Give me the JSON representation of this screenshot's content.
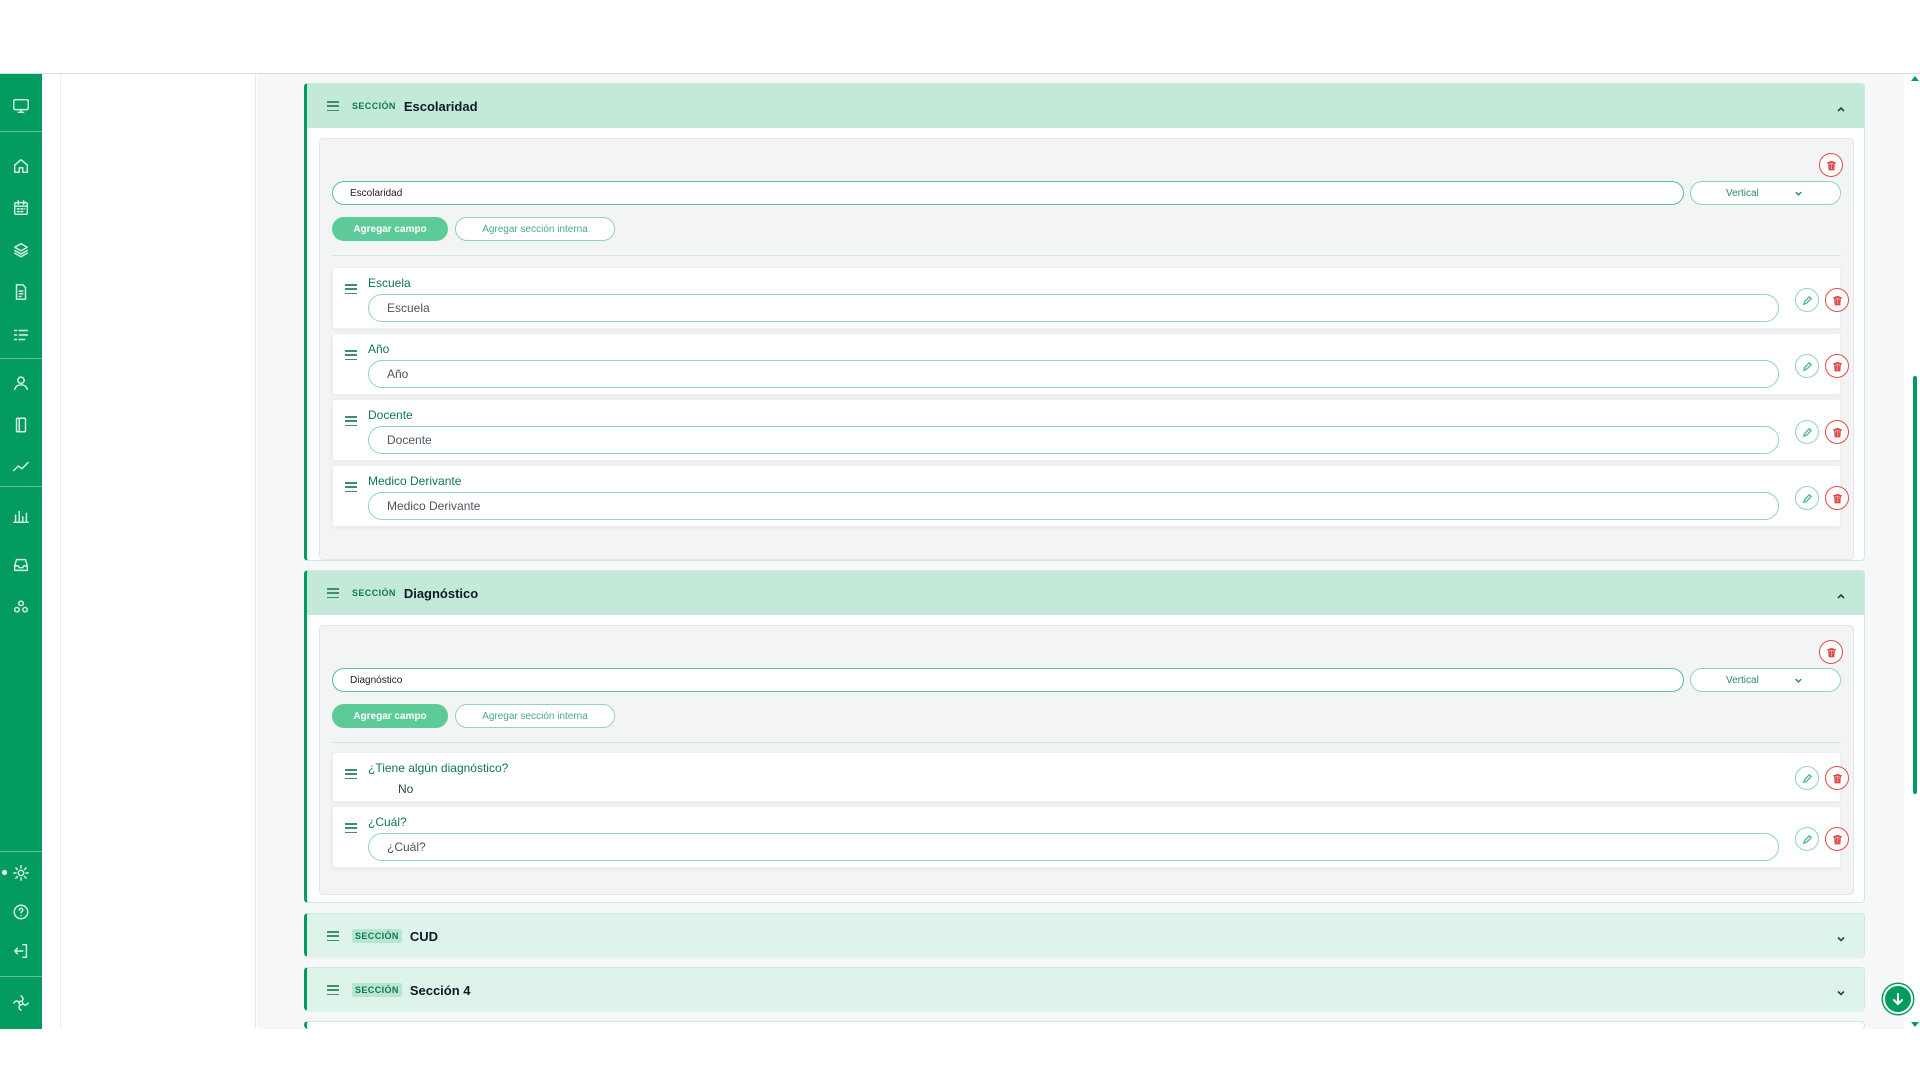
{
  "sections": [
    {
      "tag": "SECCIÓN",
      "title": "Escolaridad",
      "name_value": "Escolaridad",
      "layout": "Vertical",
      "add_field_label": "Agregar campo",
      "add_inner_label": "Agregar sección interna",
      "fields": [
        {
          "label": "Escuela",
          "placeholder": "Escuela"
        },
        {
          "label": "Año",
          "placeholder": "Año"
        },
        {
          "label": "Docente",
          "placeholder": "Docente"
        },
        {
          "label": "Medico Derivante",
          "placeholder": "Medico Derivante"
        }
      ]
    },
    {
      "tag": "SECCIÓN",
      "title": "Diagnóstico",
      "name_value": "Diagnóstico",
      "layout": "Vertical",
      "add_field_label": "Agregar campo",
      "add_inner_label": "Agregar sección interna",
      "fields": [
        {
          "label": "¿Tiene algún diagnóstico?",
          "value": "No"
        },
        {
          "label": "¿Cuál?",
          "placeholder": "¿Cuál?"
        }
      ]
    },
    {
      "tag": "SECCIÓN",
      "title": "CUD"
    },
    {
      "tag": "SECCIÓN",
      "title": "Sección 4"
    }
  ],
  "colors": {
    "brand": "#049b5f",
    "header": "#c3ead9",
    "danger": "#e14b4b",
    "accent_light": "#8fd6b5"
  }
}
